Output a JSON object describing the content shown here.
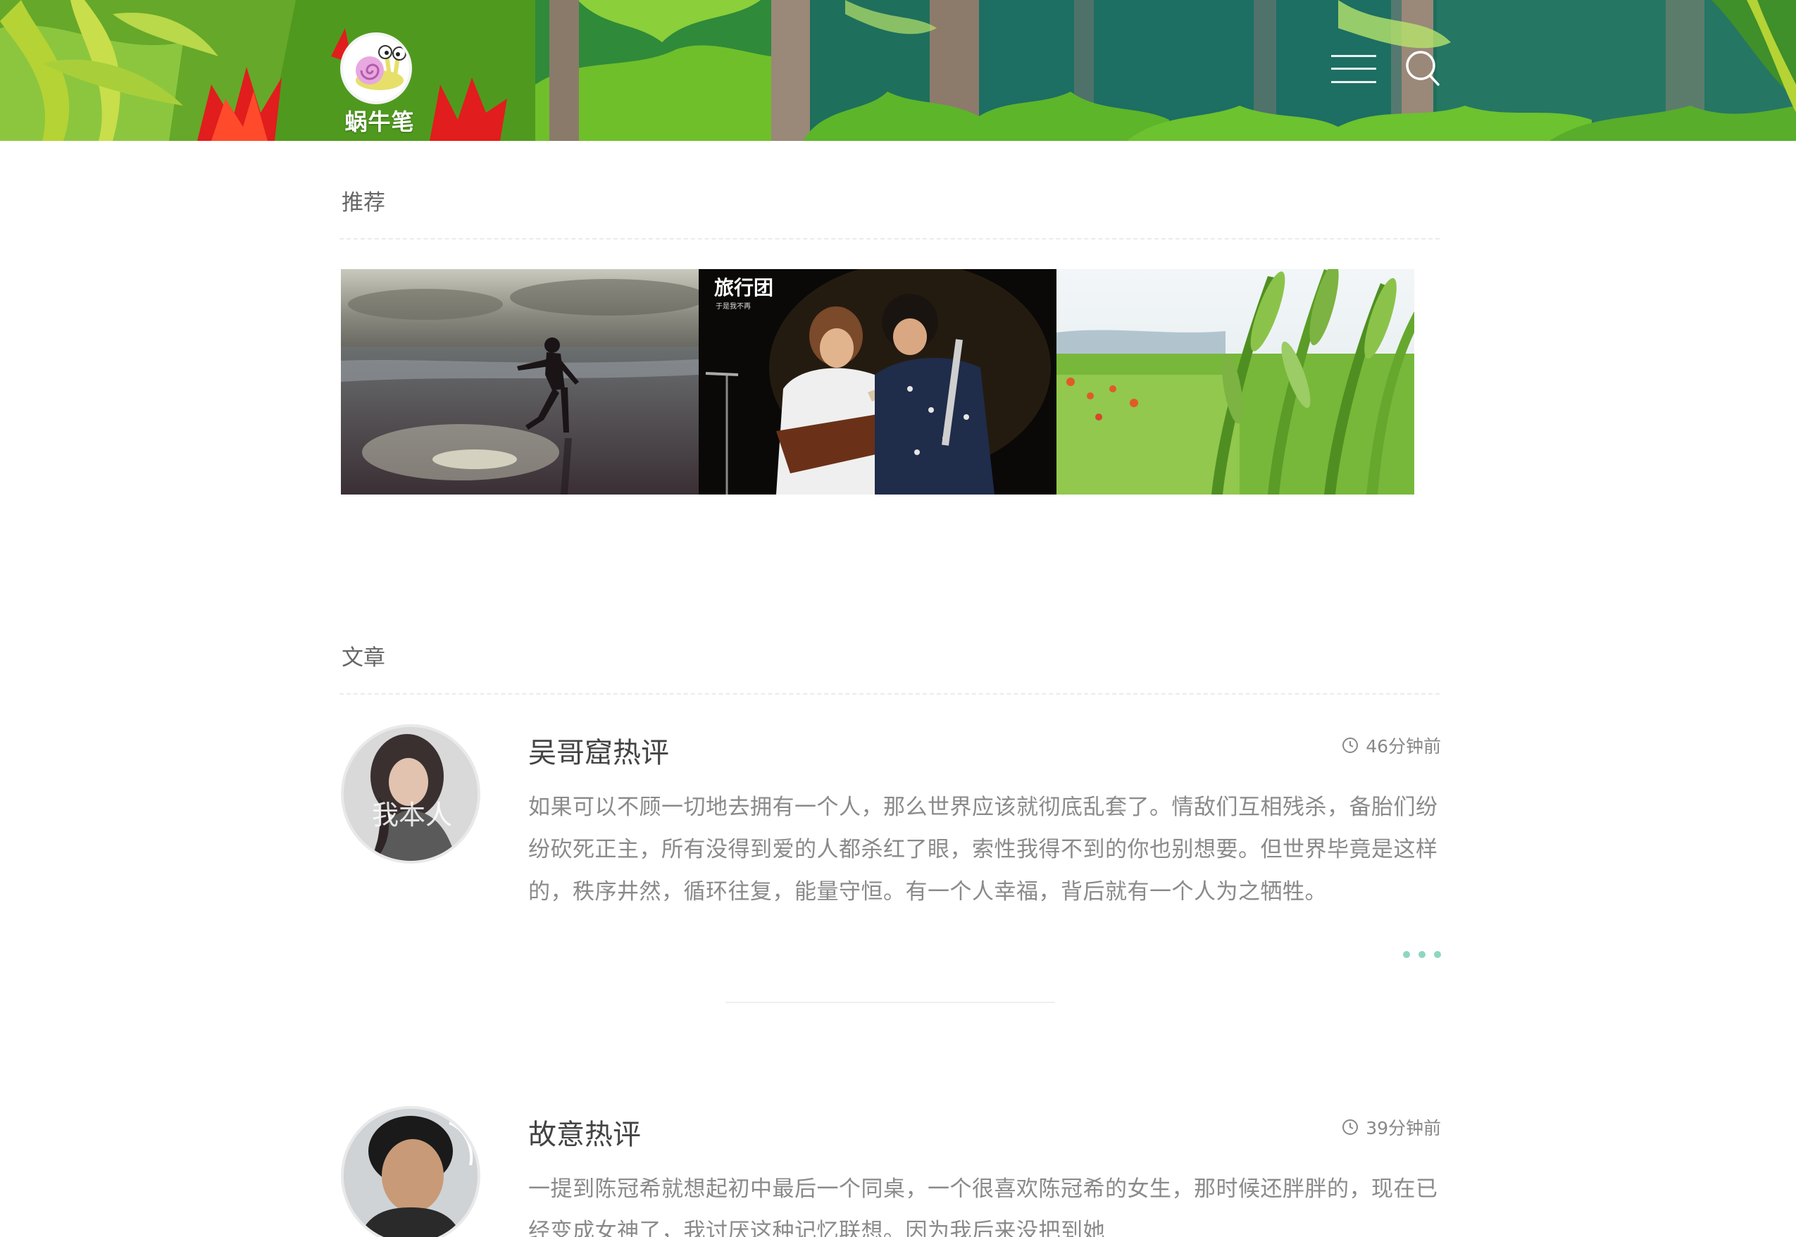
{
  "header": {
    "logo_text": "蜗牛笔记",
    "menu_icon": "hamburger-menu-icon",
    "search_icon": "search-icon"
  },
  "recommend": {
    "title": "推荐",
    "items": [
      {
        "image": "beach-silhouette-photo"
      },
      {
        "image": "band-concert-photo",
        "overlay_title": "旅行团",
        "overlay_sub": "于是我不再"
      },
      {
        "image": "wheat-field-photo"
      }
    ]
  },
  "articles_section": {
    "title": "文章"
  },
  "articles": [
    {
      "title": "吴哥窟热评",
      "time": "46分钟前",
      "excerpt": "如果可以不顾一切地去拥有一个人，那么世界应该就彻底乱套了。情敌们互相残杀，备胎们纷纷砍死正主，所有没得到爱的人都杀红了眼，索性我得不到的你也别想要。但世界毕竟是这样的，秩序井然，循环往复，能量守恒。有一个人幸福，背后就有一个人为之牺牲。",
      "avatar_text": "我本人"
    },
    {
      "title": "故意热评",
      "time": "39分钟前",
      "excerpt": "一提到陈冠希就想起初中最后一个同桌，一个很喜欢陈冠希的女生，那时候还胖胖的，现在已经变成女神了，我讨厌这种记忆联想。因为我后来没把到她"
    }
  ],
  "colors": {
    "accent_dots": "#8fd6c2",
    "text_body": "#8a8a8a",
    "text_title": "#444444"
  }
}
